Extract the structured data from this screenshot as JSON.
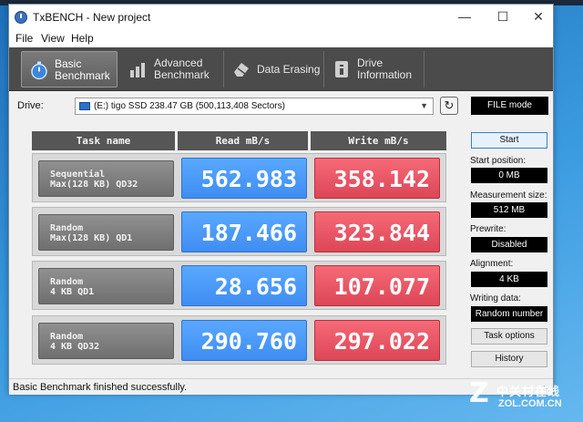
{
  "window": {
    "title": "TxBENCH - New project",
    "controls": [
      "minimize-icon",
      "maximize-icon",
      "close-icon"
    ]
  },
  "menu": [
    "File",
    "View",
    "Help"
  ],
  "tabs": [
    {
      "label_line1": "Basic",
      "label_line2": "Benchmark",
      "icon": "stopwatch-icon",
      "active": true
    },
    {
      "label_line1": "Advanced",
      "label_line2": "Benchmark",
      "icon": "bar-chart-icon",
      "active": false
    },
    {
      "label_line1": "Data Erasing",
      "label_line2": "",
      "icon": "eraser-icon",
      "active": false
    },
    {
      "label_line1": "Drive",
      "label_line2": "Information",
      "icon": "drive-info-icon",
      "active": false
    }
  ],
  "drive": {
    "label": "Drive:",
    "selected": "(E:) tigo SSD  238.47 GB (500,113,408 Sectors)",
    "mode": "FILE mode"
  },
  "grid": {
    "headers": [
      "Task name",
      "Read mB/s",
      "Write mB/s"
    ],
    "rows": [
      {
        "task": "Sequential\nMax(128 KB) QD32",
        "read": "562.983",
        "write": "358.142"
      },
      {
        "task": "Random\nMax(128 KB) QD1",
        "read": "187.466",
        "write": "323.844"
      },
      {
        "task": "Random\n4 KB QD1",
        "read": "28.656",
        "write": "107.077"
      },
      {
        "task": "Random\n4 KB QD32",
        "read": "290.760",
        "write": "297.022"
      }
    ]
  },
  "side": {
    "start": "Start",
    "start_position_label": "Start position:",
    "start_position": "0 MB",
    "measurement_size_label": "Measurement size:",
    "measurement_size": "512 MB",
    "prewrite_label": "Prewrite:",
    "prewrite": "Disabled",
    "alignment_label": "Alignment:",
    "alignment": "4 KB",
    "writing_data_label": "Writing data:",
    "writing_data": "Random number",
    "task_options": "Task options",
    "history": "History"
  },
  "status": "Basic Benchmark finished successfully.",
  "watermark": {
    "cn": "中关村在线",
    "en": "ZOL.COM.CN"
  },
  "colors": {
    "read": "#4a97f8",
    "write": "#e85263",
    "toolbar": "#4b4b4b"
  }
}
